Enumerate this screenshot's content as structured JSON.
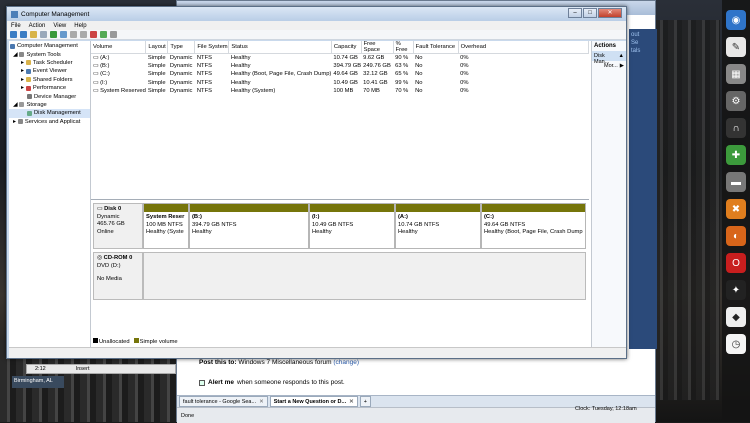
{
  "window": {
    "title": "Computer Management"
  },
  "menu": [
    "File",
    "Action",
    "View",
    "Help"
  ],
  "tree": [
    {
      "label": "Computer Management",
      "indent": 0
    },
    {
      "label": "System Tools",
      "indent": 1
    },
    {
      "label": "Task Scheduler",
      "indent": 2
    },
    {
      "label": "Event Viewer",
      "indent": 2
    },
    {
      "label": "Shared Folders",
      "indent": 2
    },
    {
      "label": "Performance",
      "indent": 2
    },
    {
      "label": "Device Manager",
      "indent": 2
    },
    {
      "label": "Storage",
      "indent": 1
    },
    {
      "label": "Disk Management",
      "indent": 2,
      "selected": true
    },
    {
      "label": "Services and Applicat",
      "indent": 1
    }
  ],
  "volume_table": {
    "columns": [
      "Volume",
      "Layout",
      "Type",
      "File System",
      "Status",
      "Capacity",
      "Free Space",
      "% Free",
      "Fault Tolerance",
      "Overhead"
    ],
    "rows": [
      [
        "(A:)",
        "Simple",
        "Dynamic",
        "NTFS",
        "Healthy",
        "10.74 GB",
        "9.62 GB",
        "90 %",
        "No",
        "0%"
      ],
      [
        "(B:)",
        "Simple",
        "Dynamic",
        "NTFS",
        "Healthy",
        "394.79 GB",
        "249.76 GB",
        "63 %",
        "No",
        "0%"
      ],
      [
        "(C:)",
        "Simple",
        "Dynamic",
        "NTFS",
        "Healthy (Boot, Page File, Crash Dump)",
        "49.64 GB",
        "32.12 GB",
        "65 %",
        "No",
        "0%"
      ],
      [
        "(I:)",
        "Simple",
        "Dynamic",
        "NTFS",
        "Healthy",
        "10.49 GB",
        "10.41 GB",
        "99 %",
        "No",
        "0%"
      ],
      [
        "System Reserved",
        "Simple",
        "Dynamic",
        "NTFS",
        "Healthy (System)",
        "100 MB",
        "70 MB",
        "70 %",
        "No",
        "0%"
      ]
    ]
  },
  "disk0": {
    "name": "Disk 0",
    "type": "Dynamic",
    "size": "465.76 GB",
    "state": "Online",
    "partitions": [
      {
        "name": "System Reser",
        "size": "100 MB NTFS",
        "status": "Healthy (Syste"
      },
      {
        "name": "(B:)",
        "size": "394.79 GB NTFS",
        "status": "Healthy"
      },
      {
        "name": "(I:)",
        "size": "10.49 GB NTFS",
        "status": "Healthy"
      },
      {
        "name": "(A:)",
        "size": "10.74 GB NTFS",
        "status": "Healthy"
      },
      {
        "name": "(C:)",
        "size": "49.64 GB NTFS",
        "status": "Healthy (Boot, Page File, Crash Dump"
      }
    ]
  },
  "cdrom": {
    "name": "CD-ROM 0",
    "drive": "DVD (D:)",
    "media": "No Media"
  },
  "legend": [
    {
      "label": "Unallocated",
      "color": "#000000"
    },
    {
      "label": "Simple volume",
      "color": "#76750a"
    }
  ],
  "actions": {
    "header": "Actions",
    "selected": "Disk Man...",
    "more": "Mor..."
  },
  "browser": {
    "post_label": "Post this to:",
    "post_value": "Windows 7 Miscellaneous forum",
    "post_link": "(change)",
    "alert_bold": "Alert me",
    "alert_rest": "when someone responds to this post.",
    "tabs": [
      "fault tolerance - Google Sea...",
      "Start a New Question or D..."
    ],
    "status": "Done",
    "clock": "Clock: Tuesday, 12:18am",
    "right_text": "out\nSe\ntals"
  },
  "left_strip": {
    "col1": "2:12",
    "col2": "Insert",
    "location": "Birmingham, AL"
  }
}
